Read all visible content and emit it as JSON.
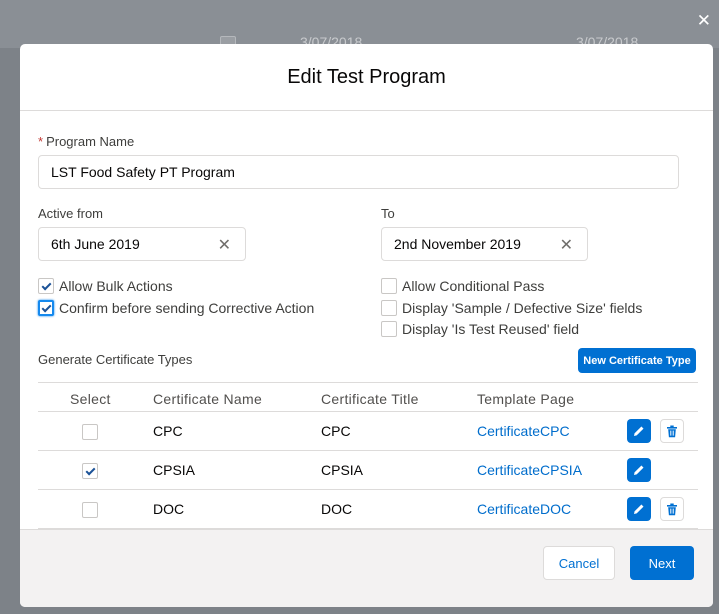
{
  "background": {
    "dates": [
      "3/07/2018",
      "3/07/2018"
    ]
  },
  "modal": {
    "title": "Edit Test Program",
    "required_marker": "*",
    "program_name": {
      "label": "Program Name",
      "value": "LST Food Safety PT Program"
    },
    "active_from": {
      "label": "Active from",
      "value": "6th June 2019"
    },
    "active_to": {
      "label": "To",
      "value": "2nd November 2019"
    },
    "options": [
      {
        "label": "Allow Bulk Actions",
        "checked": true
      },
      {
        "label": "Confirm before sending Corrective Action",
        "checked": true,
        "focused": true
      },
      {
        "label": "Allow Conditional Pass",
        "checked": false
      },
      {
        "label": "Display 'Sample / Defective Size' fields",
        "checked": false
      },
      {
        "label": "Display 'Is Test Reused' field",
        "checked": false
      }
    ],
    "certificates": {
      "section_title": "Generate Certificate Types",
      "new_button": "New Certificate Type",
      "columns": [
        "Select",
        "Certificate Name",
        "Certificate Title",
        "Template Page"
      ],
      "rows": [
        {
          "selected": false,
          "name": "CPC",
          "title": "CPC",
          "template": "CertificateCPC",
          "deletable": true
        },
        {
          "selected": true,
          "name": "CPSIA",
          "title": "CPSIA",
          "template": "CertificateCPSIA",
          "deletable": false
        },
        {
          "selected": false,
          "name": "DOC",
          "title": "DOC",
          "template": "CertificateDOC",
          "deletable": true
        }
      ]
    },
    "footer": {
      "cancel": "Cancel",
      "next": "Next"
    }
  },
  "icons": {
    "close": "close-icon",
    "clear": "clear-icon",
    "edit": "pencil-icon",
    "delete": "trash-icon",
    "check": "checkmark-icon"
  },
  "colors": {
    "brand": "#0070d2",
    "link": "#006dcc",
    "required": "#c23934"
  }
}
